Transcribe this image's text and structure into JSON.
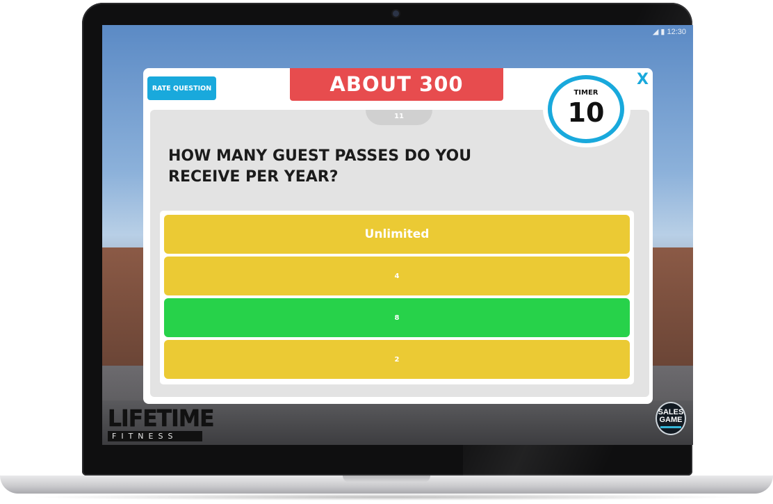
{
  "status_bar": {
    "time": "12:30",
    "signal_icon": "signal-icon",
    "battery_icon": "battery-icon"
  },
  "modal": {
    "rate_button": "RATE QUESTION",
    "answer_banner": "ABOUT  300",
    "close_label": "X",
    "timer_label": "TIMER",
    "timer_value": "10",
    "question_number": "11",
    "question": "HOW MANY GUEST PASSES DO YOU RECEIVE PER YEAR?",
    "answers": [
      {
        "label": "Unlimited",
        "color": "#ebca34"
      },
      {
        "label": "4",
        "color": "#ebca34"
      },
      {
        "label": "8",
        "color": "#27d24a"
      },
      {
        "label": "2",
        "color": "#ebca34"
      }
    ]
  },
  "branding": {
    "logo_main": "LIFETIME",
    "logo_sub": "FITNESS",
    "badge_line1": "SALES",
    "badge_line2": "GAME"
  },
  "colors": {
    "accent": "#19a9dc",
    "banner": "#e74c4e",
    "answer_default": "#ebca34",
    "answer_correct": "#27d24a"
  }
}
